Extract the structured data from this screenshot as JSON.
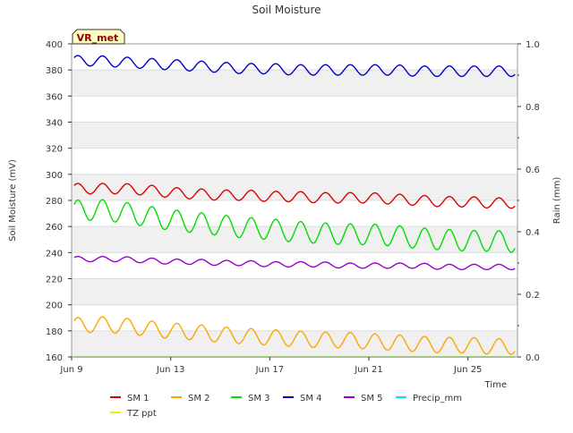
{
  "chart_data": {
    "type": "line",
    "title": "Soil Moisture",
    "station_label": "VR_met",
    "xlabel": "Time",
    "ylabel": "Soil Moisture (mV)",
    "y2label": "Rain (mm)",
    "ylim": [
      160,
      400
    ],
    "y2lim": [
      0,
      1.0
    ],
    "xlim": [
      "2024-06-09",
      "2024-06-27"
    ],
    "y_ticks": [
      160,
      180,
      200,
      220,
      240,
      260,
      280,
      300,
      320,
      340,
      360,
      380,
      400
    ],
    "y2_ticks": [
      0.0,
      0.2,
      0.4,
      0.6,
      0.8,
      1.0
    ],
    "y2_tick_labels": [
      "0.0",
      "0.2",
      "0.4",
      "0.6",
      "0.8",
      "1.0"
    ],
    "x_ticks": [
      "Jun 9",
      "Jun 13",
      "Jun 17",
      "Jun 21",
      "Jun 25"
    ],
    "x_tick_dates": [
      "2024-06-09",
      "2024-06-13",
      "2024-06-17",
      "2024-06-21",
      "2024-06-25"
    ],
    "band_stripes": true,
    "legend_position": "bottom",
    "series": [
      {
        "name": "SM 1",
        "color": "#dd0000",
        "axis": "left",
        "x": [
          "2024-06-09",
          "2024-06-10",
          "2024-06-11",
          "2024-06-12",
          "2024-06-13",
          "2024-06-14",
          "2024-06-15",
          "2024-06-16",
          "2024-06-17",
          "2024-06-18",
          "2024-06-19",
          "2024-06-20",
          "2024-06-21",
          "2024-06-22",
          "2024-06-23",
          "2024-06-24",
          "2024-06-25",
          "2024-06-26",
          "2024-06-27"
        ],
        "values": [
          289,
          289,
          289,
          288,
          286,
          285,
          284,
          284,
          283,
          283,
          282,
          282,
          282,
          281,
          280,
          279,
          279,
          278,
          278
        ],
        "amplitude": 4
      },
      {
        "name": "SM 2",
        "color": "#ffa500",
        "axis": "left",
        "x": [
          "2024-06-09",
          "2024-06-10",
          "2024-06-11",
          "2024-06-12",
          "2024-06-13",
          "2024-06-14",
          "2024-06-15",
          "2024-06-16",
          "2024-06-17",
          "2024-06-18",
          "2024-06-19",
          "2024-06-20",
          "2024-06-21",
          "2024-06-22",
          "2024-06-23",
          "2024-06-24",
          "2024-06-25",
          "2024-06-26",
          "2024-06-27"
        ],
        "values": [
          184,
          185,
          184,
          182,
          180,
          179,
          177,
          176,
          175,
          174,
          173,
          173,
          172,
          171,
          170,
          169,
          169,
          168,
          168
        ],
        "amplitude": 6
      },
      {
        "name": "SM 3",
        "color": "#00dd00",
        "axis": "left",
        "x": [
          "2024-06-09",
          "2024-06-10",
          "2024-06-11",
          "2024-06-12",
          "2024-06-13",
          "2024-06-14",
          "2024-06-15",
          "2024-06-16",
          "2024-06-17",
          "2024-06-18",
          "2024-06-19",
          "2024-06-20",
          "2024-06-21",
          "2024-06-22",
          "2024-06-23",
          "2024-06-24",
          "2024-06-25",
          "2024-06-26",
          "2024-06-27"
        ],
        "values": [
          272,
          273,
          271,
          268,
          265,
          263,
          261,
          259,
          258,
          256,
          255,
          254,
          254,
          253,
          251,
          250,
          249,
          249,
          248
        ],
        "amplitude": 8
      },
      {
        "name": "SM 4",
        "color": "#0000cc",
        "axis": "left",
        "x": [
          "2024-06-09",
          "2024-06-10",
          "2024-06-11",
          "2024-06-12",
          "2024-06-13",
          "2024-06-14",
          "2024-06-15",
          "2024-06-16",
          "2024-06-17",
          "2024-06-18",
          "2024-06-19",
          "2024-06-20",
          "2024-06-21",
          "2024-06-22",
          "2024-06-23",
          "2024-06-24",
          "2024-06-25",
          "2024-06-26",
          "2024-06-27"
        ],
        "values": [
          387,
          387,
          386,
          385,
          384,
          383,
          382,
          381,
          381,
          380,
          380,
          380,
          380,
          380,
          379,
          379,
          379,
          379,
          379
        ],
        "amplitude": 4
      },
      {
        "name": "SM 5",
        "color": "#9900cc",
        "axis": "left",
        "x": [
          "2024-06-09",
          "2024-06-10",
          "2024-06-11",
          "2024-06-12",
          "2024-06-13",
          "2024-06-14",
          "2024-06-15",
          "2024-06-16",
          "2024-06-17",
          "2024-06-18",
          "2024-06-19",
          "2024-06-20",
          "2024-06-21",
          "2024-06-22",
          "2024-06-23",
          "2024-06-24",
          "2024-06-25",
          "2024-06-26",
          "2024-06-27"
        ],
        "values": [
          235,
          235,
          235,
          234,
          233,
          233,
          232,
          232,
          231,
          231,
          231,
          230,
          230,
          230,
          230,
          229,
          229,
          229,
          229
        ],
        "amplitude": 2
      },
      {
        "name": "Precip_mm",
        "color": "#00e5e5",
        "axis": "right",
        "x": [
          "2024-06-09",
          "2024-06-27"
        ],
        "values": [
          0,
          0
        ],
        "amplitude": 0
      },
      {
        "name": "TZ ppt",
        "color": "#eeee00",
        "axis": "right",
        "x": [
          "2024-06-09",
          "2024-06-27"
        ],
        "values": [
          0,
          0
        ],
        "amplitude": 0
      }
    ]
  }
}
